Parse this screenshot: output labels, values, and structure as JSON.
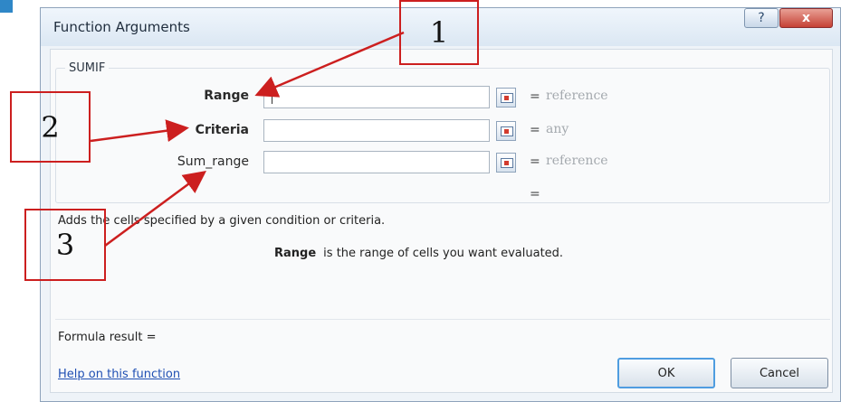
{
  "dialog": {
    "title": "Function Arguments",
    "help_button": "?",
    "close_button": "x"
  },
  "function": {
    "name": "SUMIF",
    "args": [
      {
        "label": "Range",
        "value": "",
        "hint": "reference",
        "bold": true
      },
      {
        "label": "Criteria",
        "value": "",
        "hint": "any",
        "bold": true
      },
      {
        "label": "Sum_range",
        "value": "",
        "hint": "reference",
        "bold": false
      }
    ],
    "result_equals": "=",
    "description": "Adds the cells specified by a given condition or criteria.",
    "arg_description": {
      "name": "Range",
      "text": "is the range of cells you want evaluated."
    }
  },
  "footer": {
    "formula_result": "Formula result =",
    "help_link": "Help on this function",
    "ok": "OK",
    "cancel": "Cancel"
  },
  "annotations": [
    "1",
    "2",
    "3"
  ],
  "colors": {
    "annotation": "#cc1f1f",
    "dialog_bg": "#eef3f8",
    "link": "#1f4fb3",
    "hint": "#a4a9ae"
  }
}
